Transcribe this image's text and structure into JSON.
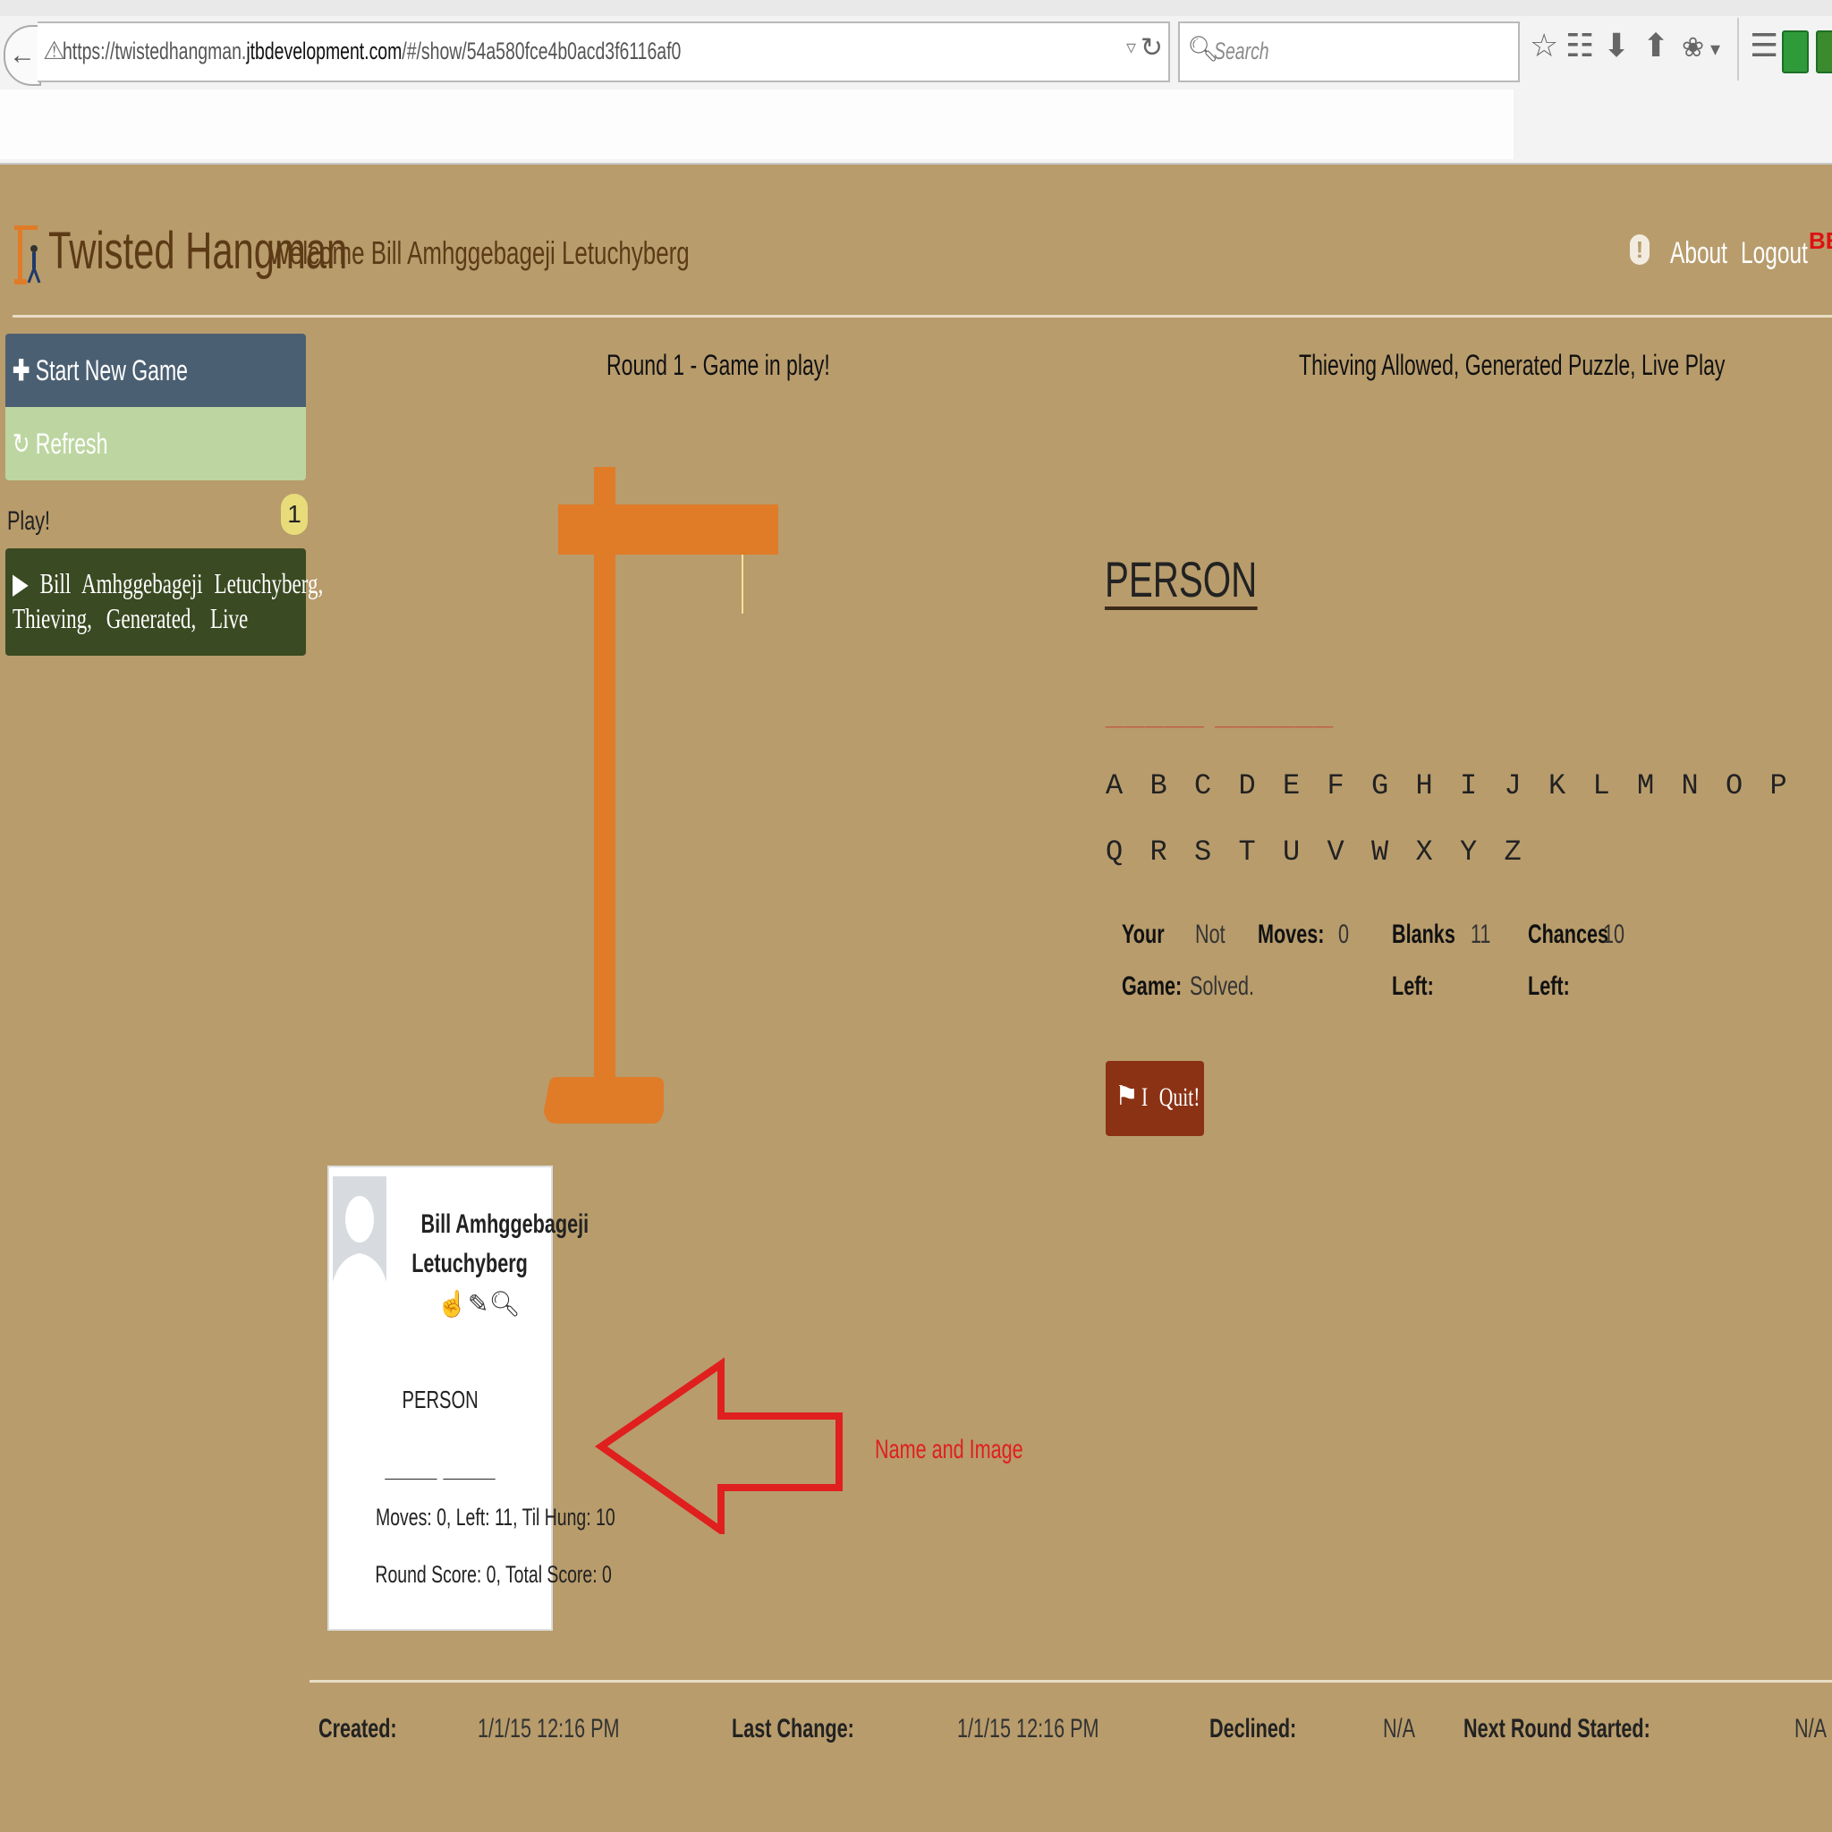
{
  "browser": {
    "url_prefix": "https://twistedhangman.",
    "url_domain": "jtbdevelopment.com",
    "url_suffix": "/#/show/54a580fce4b0acd3f6116af0",
    "search_placeholder": "Search",
    "icons": [
      "back-arrow-icon",
      "warning-icon",
      "dropdown-icon",
      "reload-icon",
      "search-icon",
      "star-icon",
      "clipboard-icon",
      "download-icon",
      "home-icon",
      "extension-icon",
      "menu-icon"
    ]
  },
  "header": {
    "title": "Twisted Hangman",
    "welcome": "Welcome Bill Amhggebageji Letuchyberg",
    "help": "!",
    "about": "About",
    "logout": "Logout",
    "beta": "BE"
  },
  "sidebar": {
    "new_game": "Start New Game",
    "refresh": "Refresh",
    "play_label": "Play!",
    "play_count": "1",
    "game_entry_line1": "Bill Amhggebageji Letuchyberg,",
    "game_entry_line2": "Thieving, Generated, Live"
  },
  "game": {
    "round_status": "Round 1 - Game in play!",
    "features": "Thieving Allowed, Generated Puzzle, Live Play",
    "category": "PERSON",
    "blanks": "_____ ______",
    "letters_row1": [
      "A",
      "B",
      "C",
      "D",
      "E",
      "F",
      "G",
      "H",
      "I",
      "J",
      "K",
      "L",
      "M",
      "N",
      "O",
      "P"
    ],
    "letters_row2": [
      "Q",
      "R",
      "S",
      "T",
      "U",
      "V",
      "W",
      "X",
      "Y",
      "Z"
    ],
    "stats": {
      "your_game_label_1": "Your",
      "your_game_label_2": "Game:",
      "your_game_value_1": "Not",
      "your_game_value_2": "Solved.",
      "moves_label": "Moves:",
      "moves_value": "0",
      "blanks_label_1": "Blanks",
      "blanks_label_2": "Left:",
      "blanks_value": "11",
      "chances_label_1": "Chances",
      "chances_label_2": "Left:",
      "chances_value": "10"
    },
    "quit": "I Quit!"
  },
  "player_card": {
    "name_line1": "Bill Amhggebageji",
    "name_line2": "Letuchyberg",
    "icons": [
      "thumbs-up-icon",
      "pencil-icon",
      "search-icon"
    ],
    "category": "PERSON",
    "blanks": "____ ____",
    "stats": "Moves: 0, Left: 11, Til Hung: 10",
    "score": "Round Score: 0, Total Score: 0"
  },
  "annotation": {
    "label": "Name and Image",
    "color": "#e01f1f"
  },
  "footer": {
    "created_label": "Created:",
    "created_value": "1/1/15 12:16 PM",
    "last_change_label": "Last Change:",
    "last_change_value": "1/1/15 12:16 PM",
    "declined_label": "Declined:",
    "declined_value": "N/A",
    "next_round_label": "Next Round Started:",
    "next_round_value": "N/A"
  },
  "colors": {
    "background": "#b89c6c",
    "gallows": "#e07b28",
    "new_game_button": "#4b5f72",
    "refresh_button": "#bdd6a1",
    "game_entry": "#3a4a22",
    "quit_button": "#8b3214"
  }
}
